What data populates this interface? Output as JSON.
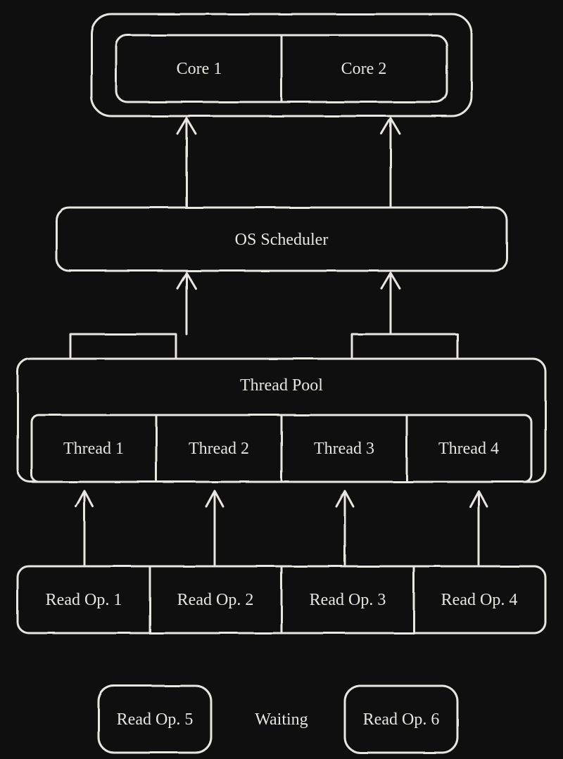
{
  "cpu": {
    "core1": "Core 1",
    "core2": "Core 2"
  },
  "scheduler": {
    "label": "OS Scheduler"
  },
  "pool": {
    "label": "Thread Pool",
    "threads": [
      "Thread 1",
      "Thread 2",
      "Thread 3",
      "Thread 4"
    ]
  },
  "ops": {
    "active": [
      "Read Op. 1",
      "Read Op. 2",
      "Read Op. 3",
      "Read Op. 4"
    ],
    "waiting_label": "Waiting",
    "waiting": [
      "Read Op. 5",
      "Read Op. 6"
    ]
  }
}
